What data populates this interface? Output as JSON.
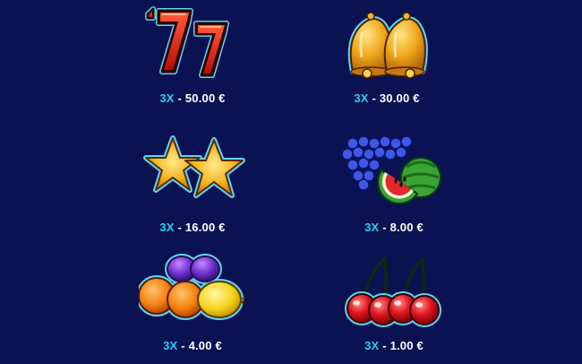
{
  "paytable": {
    "rows": [
      {
        "id": "sevens",
        "icon": "triple-seven-icon",
        "multiplier": "3X",
        "separator": " - ",
        "amount": "50.00 €"
      },
      {
        "id": "bells",
        "icon": "bells-icon",
        "multiplier": "3X",
        "separator": " - ",
        "amount": "30.00 €"
      },
      {
        "id": "stars",
        "icon": "stars-icon",
        "multiplier": "3X",
        "separator": " - ",
        "amount": "16.00 €"
      },
      {
        "id": "grapes",
        "icon": "grapes-watermelon-icon",
        "multiplier": "3X",
        "separator": " - ",
        "amount": "8.00 €"
      },
      {
        "id": "fruits",
        "icon": "orange-lemon-plum-icon",
        "multiplier": "3X",
        "separator": " - ",
        "amount": "4.00 €"
      },
      {
        "id": "cherries",
        "icon": "cherries-icon",
        "multiplier": "3X",
        "separator": " - ",
        "amount": "1.00 €"
      }
    ]
  },
  "colors": {
    "background": "#0b1251",
    "multiplier": "#29d0f2",
    "amount": "#ffffff",
    "outline": "#5ed3f6"
  }
}
